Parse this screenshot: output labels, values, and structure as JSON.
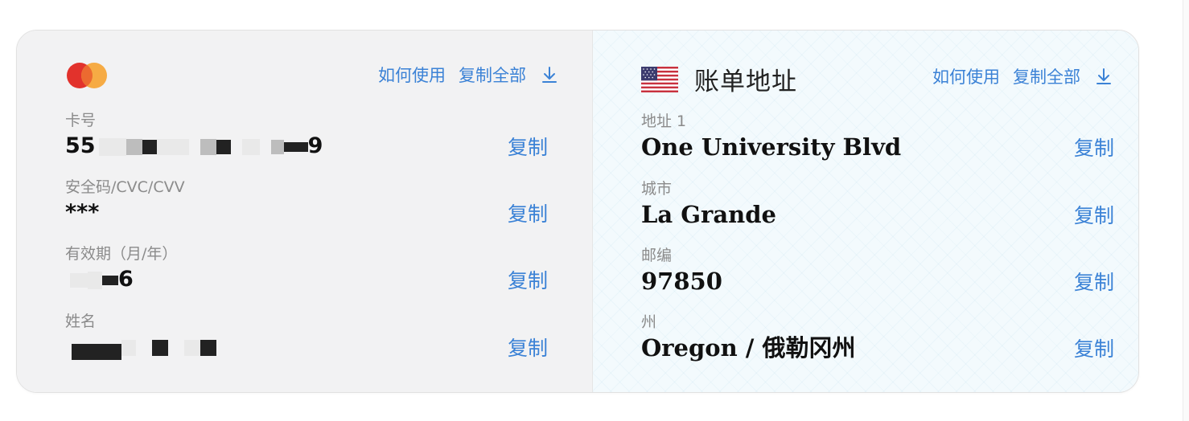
{
  "card": {
    "actions": {
      "how_to": "如何使用",
      "copy_all": "复制全部",
      "download_icon": "download-icon"
    },
    "brand_icon": "mastercard-icon",
    "fields": [
      {
        "label": "卡号",
        "value": "55",
        "value_suffix": "9",
        "copy": "复制"
      },
      {
        "label": "安全码/CVC/CVV",
        "value": "***",
        "copy": "复制"
      },
      {
        "label": "有效期（月/年）",
        "value": "6",
        "copy": "复制"
      },
      {
        "label": "姓名",
        "value": "",
        "copy": "复制"
      }
    ]
  },
  "billing": {
    "flag_icon": "us-flag-icon",
    "title": "账单地址",
    "actions": {
      "how_to": "如何使用",
      "copy_all": "复制全部",
      "download_icon": "download-icon"
    },
    "fields": [
      {
        "label": "地址 1",
        "value": "One University Blvd",
        "copy": "复制"
      },
      {
        "label": "城市",
        "value": "La Grande",
        "copy": "复制"
      },
      {
        "label": "邮编",
        "value": "97850",
        "copy": "复制"
      },
      {
        "label": "州",
        "value": "Oregon / 俄勒冈州",
        "copy": "复制"
      }
    ]
  },
  "colors": {
    "accent": "#3b82d6",
    "mc_red": "#e2322c",
    "mc_orange": "#f5a63a"
  }
}
